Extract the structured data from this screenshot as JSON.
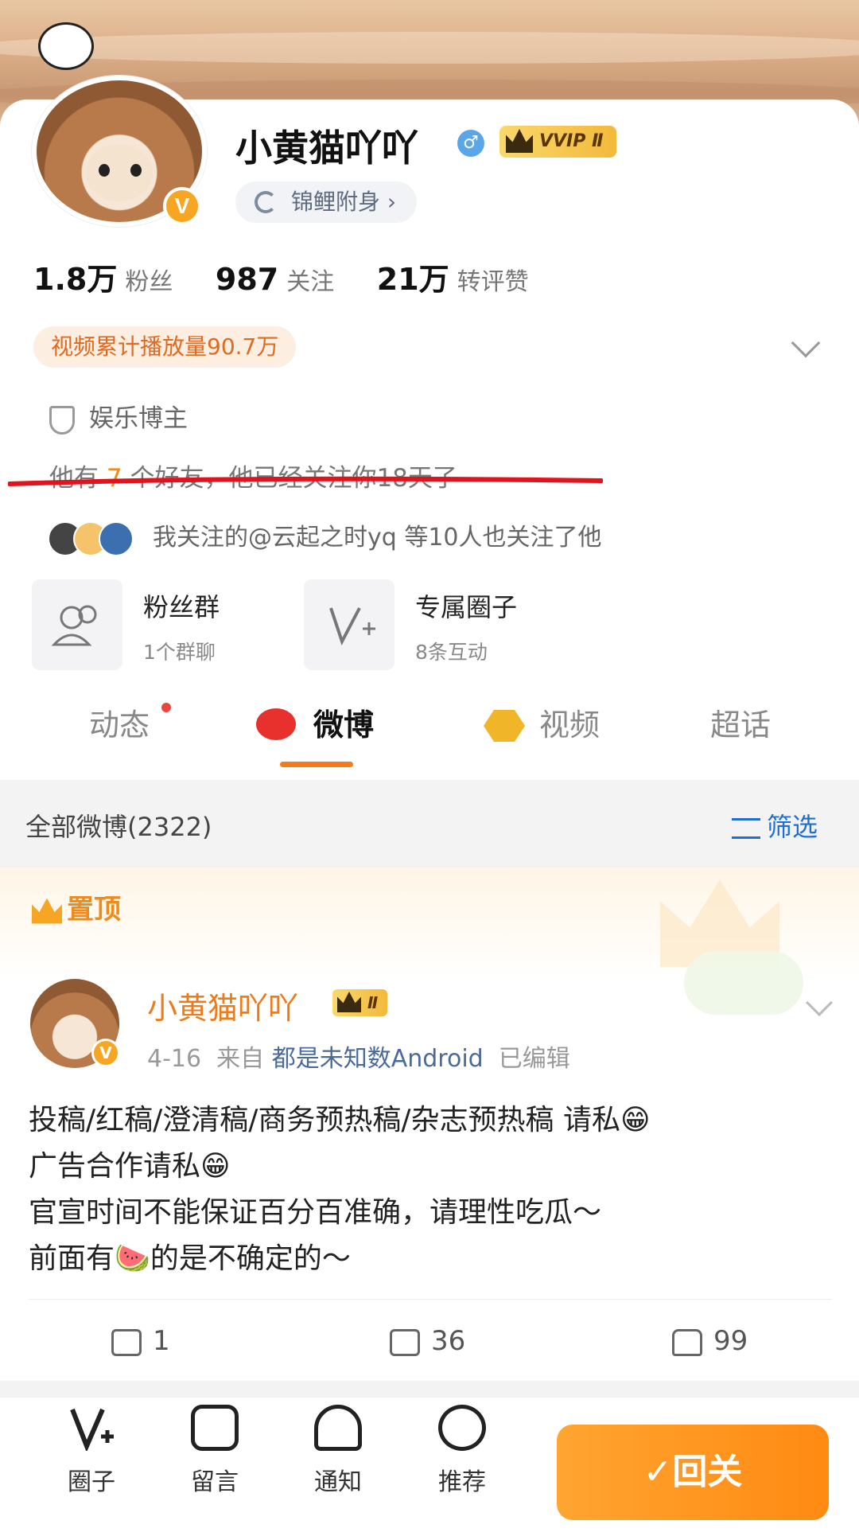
{
  "profile": {
    "name": "小黄猫吖吖",
    "vip_label": "VVIP Ⅱ",
    "koi_label": "锦鲤附身 ›",
    "verified_mark": "V",
    "gender_mark": "♂"
  },
  "stats": [
    {
      "value": "1.8万",
      "label": "粉丝"
    },
    {
      "value": "987",
      "label": "关注"
    },
    {
      "value": "21万",
      "label": "转评赞"
    }
  ],
  "play_count": "视频累计播放量90.7万",
  "tagline": "娱乐博主",
  "friends": {
    "prefix": "他有 ",
    "count": "7",
    "suffix": " 个好友，他已经关注你18天了"
  },
  "mutual_follow": "我关注的@云起之时yq 等10人也关注了他",
  "groups": [
    {
      "title": "粉丝群",
      "subtitle": "1个群聊"
    },
    {
      "title": "专属圈子",
      "subtitle": "8条互动"
    }
  ],
  "tabs": [
    "动态",
    "微博",
    "视频",
    "超话"
  ],
  "feed_header": {
    "all_label": "全部微博(2322)",
    "filter_label": "筛选"
  },
  "pinned_label": "置顶",
  "post": {
    "author": "小黄猫吖吖",
    "crown_label": "Ⅱ",
    "date": "4-16",
    "from_label": "来自",
    "source": "都是未知数Android",
    "edited": "已编辑",
    "lines": [
      "投稿/红稿/澄清稿/商务预热稿/杂志预热稿 请私😁",
      "广告合作请私😁",
      "官宣时间不能保证百分百准确，请理性吃瓜～",
      "前面有🍉的是不确定的～"
    ],
    "reposts": "1",
    "comments": "36",
    "likes": "99"
  },
  "bottom_nav": [
    {
      "label": "圈子",
      "icon": "circle-icon"
    },
    {
      "label": "留言",
      "icon": "message-icon"
    },
    {
      "label": "通知",
      "icon": "bell-icon"
    },
    {
      "label": "推荐",
      "icon": "recommend-icon"
    }
  ],
  "follow_back_label": "✓回关",
  "colors": {
    "accent": "#ff8a12",
    "link": "#1f6fd1",
    "highlight": "#f08c1a",
    "underline_red": "#e0141e"
  }
}
